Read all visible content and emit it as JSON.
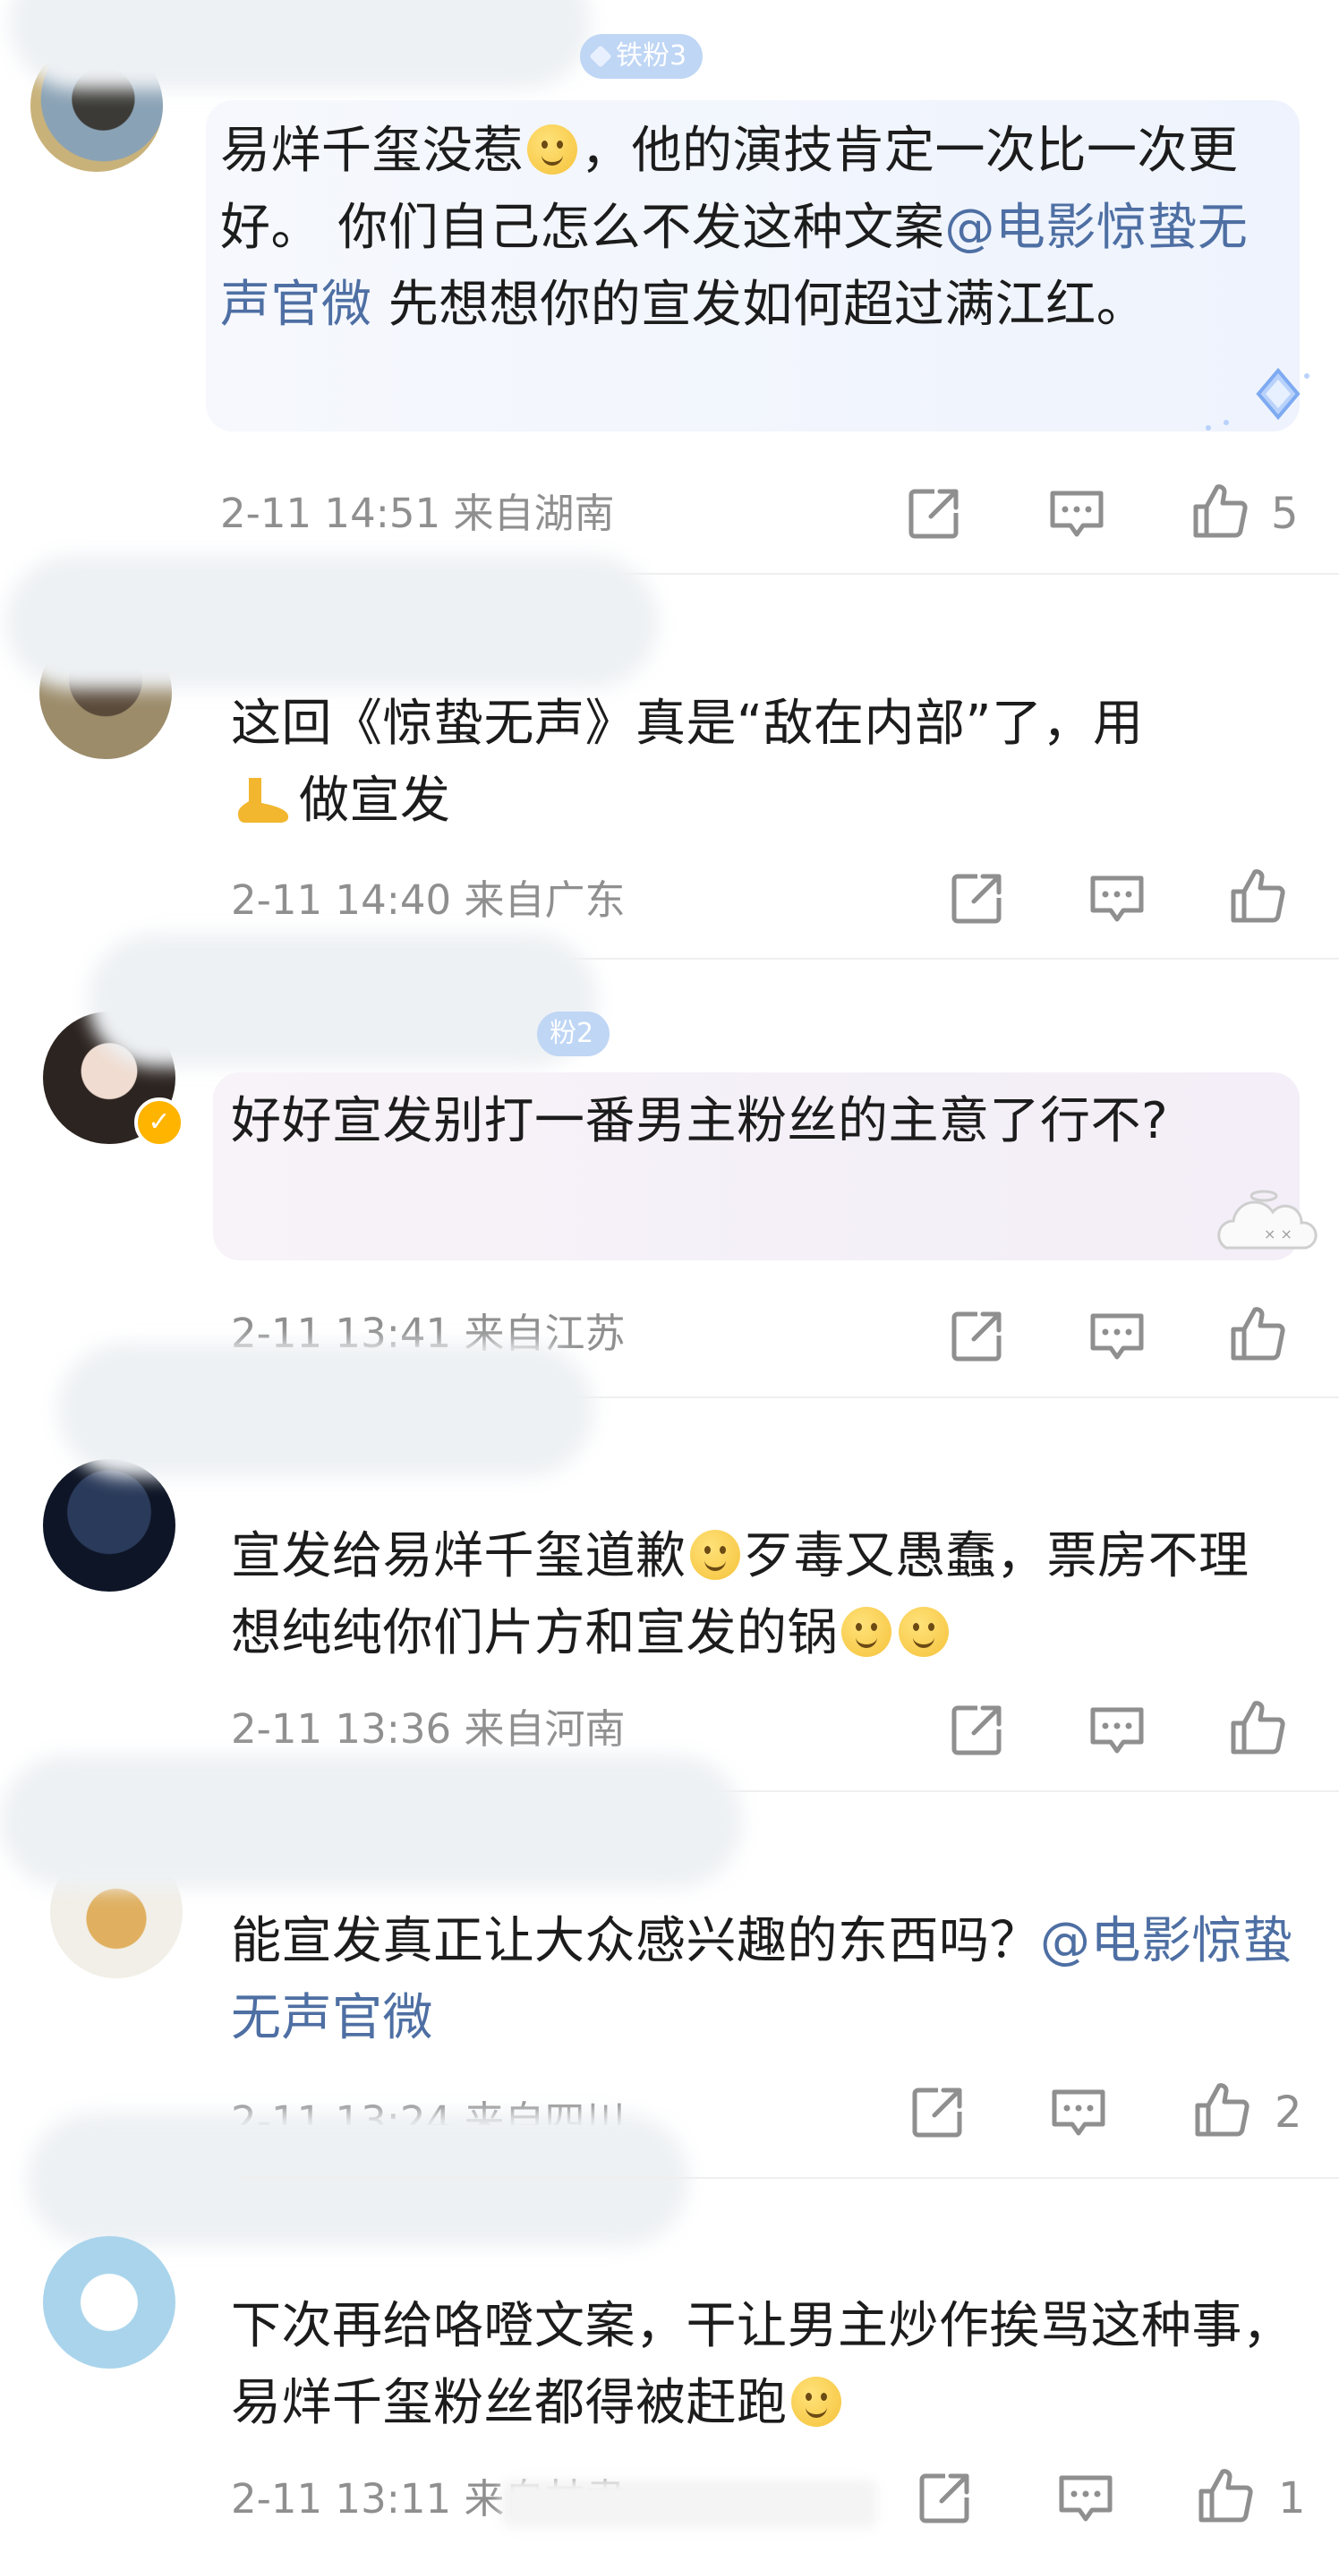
{
  "comments": [
    {
      "badge": "铁粉3",
      "text_parts": [
        "易烊千玺没惹",
        "，他的演技肯定一次比一次更好。 你们自己怎么不发这种文案",
        "@电影惊蛰无声官微",
        " 先想想你的宣发如何超过满江红。"
      ],
      "time": "2-11 14:51",
      "location": "来自湖南",
      "likes": "5"
    },
    {
      "text_parts": [
        "这回《惊蛰无声》真是“敌在内部”了，用",
        "做宣发"
      ],
      "time": "2-11 14:40",
      "location": "来自广东",
      "likes": ""
    },
    {
      "badge": "粉2",
      "text_parts": [
        "好好宣发别打一番男主粉丝的主意了行不?"
      ],
      "time": "2-11 13:41",
      "location": "来自江苏",
      "likes": ""
    },
    {
      "text_parts": [
        "宣发给易烊千玺道歉",
        "歹毒又愚蠢，票房不理想纯纯你们片方和宣发的锅"
      ],
      "time": "2-11 13:36",
      "location": "来自河南",
      "likes": ""
    },
    {
      "text_parts": [
        "能宣发真正让大众感兴趣的东西吗？",
        "@电影惊蛰无声官微"
      ],
      "time": "2-11 13:24",
      "location": "来自四川",
      "likes": "2"
    },
    {
      "text_parts": [
        "下次再给咯噔文案，干让男主炒作挨骂这种事，易烊千玺粉丝都得被赶跑"
      ],
      "time": "2-11 13:11",
      "location": "来自甘肃",
      "likes": "1"
    }
  ],
  "colors": {
    "link": "#4e6fa3",
    "meta": "#8f8f8f",
    "badge": "#bfd6f5"
  },
  "icons": [
    "share-icon",
    "comment-icon",
    "like-icon",
    "smile-emoji-icon",
    "foot-emoji-icon",
    "verified-icon"
  ]
}
